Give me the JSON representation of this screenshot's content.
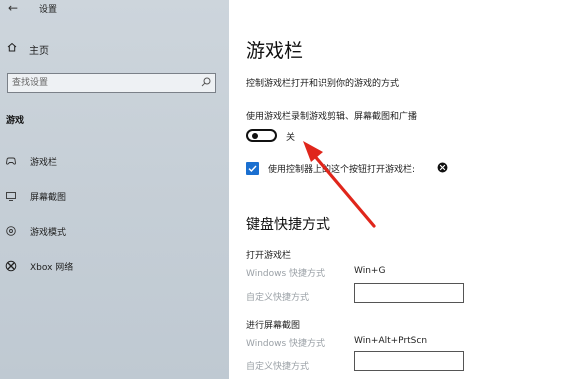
{
  "window": {
    "back": "←",
    "title": "设置"
  },
  "sidebar": {
    "home_label": "主页",
    "search_placeholder": "查找设置",
    "section_title": "游戏",
    "items": [
      {
        "label": "游戏栏",
        "icon": "game-bar-icon"
      },
      {
        "label": "屏幕截图",
        "icon": "screenshot-icon"
      },
      {
        "label": "游戏模式",
        "icon": "game-mode-icon"
      },
      {
        "label": "Xbox 网络",
        "icon": "xbox-icon"
      }
    ]
  },
  "main": {
    "title": "游戏栏",
    "description": "控制游戏栏打开和识别你的游戏的方式",
    "record_setting_label": "使用游戏栏录制游戏剪辑、屏幕截图和广播",
    "toggle_state": "关",
    "toggle_on": false,
    "controller_checkbox_label": "使用控制器上的这个按钮打开游戏栏:",
    "controller_checked": true,
    "shortcuts_title": "键盘快捷方式",
    "shortcut_groups": [
      {
        "name": "打开游戏栏",
        "windows_label": "Windows 快捷方式",
        "windows_value": "Win+G",
        "custom_label": "自定义快捷方式",
        "custom_value": ""
      },
      {
        "name": "进行屏幕截图",
        "windows_label": "Windows 快捷方式",
        "windows_value": "Win+Alt+PrtScn",
        "custom_label": "自定义快捷方式",
        "custom_value": ""
      }
    ]
  },
  "colors": {
    "sidebar_bg": "#c5ced6",
    "accent": "#1a6fd0",
    "annotation_arrow": "#e0261b"
  }
}
